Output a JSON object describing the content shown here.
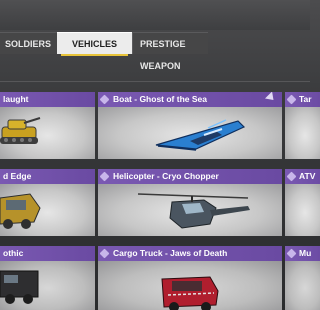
{
  "tabs": {
    "soldiers": "SOLDIERS",
    "vehicles": "VEHICLES",
    "prestige": "PRESTIGE WEAPON"
  },
  "cards": [
    {
      "title": "laught",
      "icon": "diamond-icon"
    },
    {
      "title": "Boat - Ghost of the Sea",
      "icon": "diamond-icon"
    },
    {
      "title": "Tar",
      "icon": "diamond-icon"
    },
    {
      "title": "d Edge",
      "icon": "diamond-icon"
    },
    {
      "title": "Helicopter - Cryo Chopper",
      "icon": "diamond-icon"
    },
    {
      "title": "ATV",
      "icon": "diamond-icon"
    },
    {
      "title": "othic",
      "icon": "diamond-icon"
    },
    {
      "title": "Cargo Truck - Jaws of Death",
      "icon": "diamond-icon"
    },
    {
      "title": "Mu",
      "icon": "diamond-icon"
    }
  ],
  "colors": {
    "card_header": "#7a59b2",
    "tab_active": "#ececec",
    "tab_underline": "#e8c43a"
  }
}
